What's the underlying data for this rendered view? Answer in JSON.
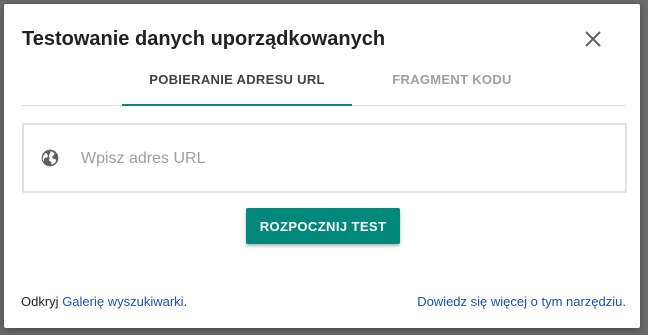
{
  "dialog": {
    "title": "Testowanie danych uporządkowanych",
    "close_icon": "close-icon"
  },
  "tabs": [
    {
      "label": "POBIERANIE ADRESU URL",
      "active": true
    },
    {
      "label": "FRAGMENT KODU",
      "active": false
    }
  ],
  "url_field": {
    "icon": "globe-icon",
    "placeholder": "Wpisz adres URL",
    "value": ""
  },
  "start_button": {
    "label": "ROZPOCZNIJ TEST"
  },
  "footer": {
    "prefix": "Odkryj",
    "gallery_link": "Galerię wyszukiwarki",
    "suffix": ".",
    "learn_more_link": "Dowiedz się więcej o tym narzędziu."
  },
  "colors": {
    "accent": "#00897b",
    "link": "#1a4fb5",
    "backdrop": "#6b6b6b"
  }
}
